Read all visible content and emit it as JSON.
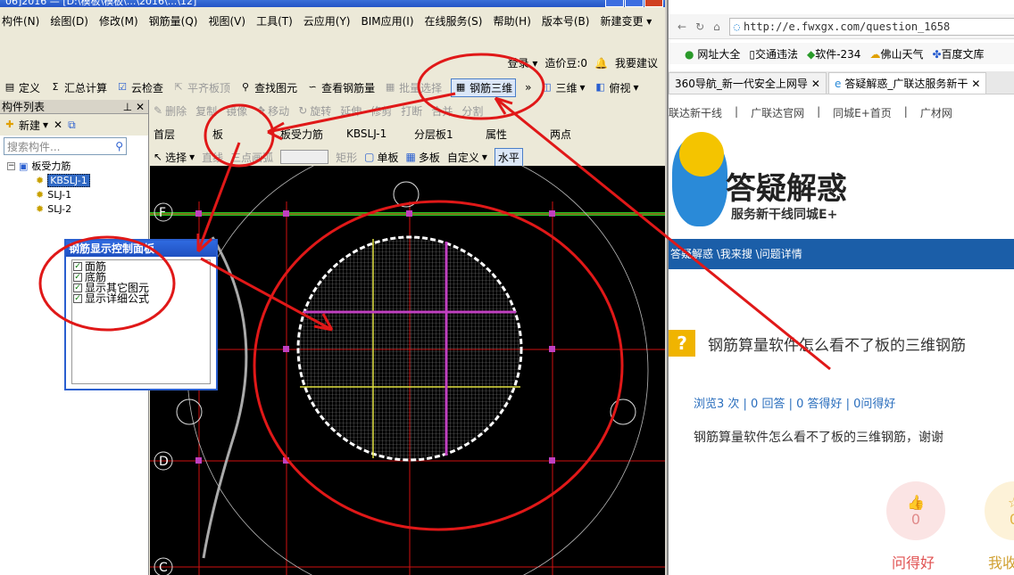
{
  "app": {
    "title_fragment": "06]2016 — [D:\\模板\\模板\\...\\2016\\...\\12]",
    "menu": [
      "构件(N)",
      "绘图(D)",
      "修改(M)",
      "钢筋量(Q)",
      "视图(V)",
      "工具(T)",
      "云应用(Y)",
      "BIM应用(I)",
      "在线服务(S)",
      "帮助(H)",
      "版本号(B)",
      "新建变更 ▾"
    ],
    "top_right": {
      "login": "登录 ▾",
      "points": "造价豆:0",
      "feedback": "我要建议"
    },
    "toolbar1": [
      "定义",
      "汇总计算",
      "云检查",
      "平齐板顶",
      "查找图元",
      "查看钢筋量",
      "批量选择",
      "钢筋三维",
      "三维",
      "俯视"
    ],
    "toolbar2": [
      "删除",
      "复制",
      "镜像",
      "移动",
      "旋转",
      "延伸",
      "修剪",
      "打断",
      "合并",
      "分割"
    ],
    "toolbar3": {
      "floor": "首层",
      "type": "板",
      "sub_type": "板受力筋",
      "component": "KBSLJ-1",
      "layer": "分层板1",
      "attr": "属性",
      "two_point": "两点"
    },
    "toolbar4": [
      "选择",
      "直线",
      "三点画弧",
      "矩形",
      "单板",
      "多板",
      "自定义",
      "水平"
    ],
    "panel": {
      "title": "构件列表",
      "new_label": "新建",
      "search_placeholder": "搜索构件...",
      "tree_root": "板受力筋",
      "tree_items": [
        "KBSLJ-1",
        "SLJ-1",
        "SLJ-2"
      ]
    },
    "axis_labels": [
      "F",
      "D",
      "C"
    ],
    "control_panel": {
      "title": "钢筋显示控制面板",
      "items": [
        "面筋",
        "底筋",
        "显示其它图元",
        "显示详细公式"
      ]
    }
  },
  "browser": {
    "url": "http://e.fwxgx.com/question_1658",
    "bookmarks": [
      "网址大全",
      "交通违法",
      "软件-234",
      "佛山天气",
      "百度文库"
    ],
    "tabs": [
      "360导航_新一代安全上网导",
      "答疑解惑_广联达服务新干"
    ],
    "site_nav": [
      "联达新干线",
      "广联达官网",
      "同城E+首页",
      "广材网"
    ],
    "logo_title": "答疑解惑",
    "logo_sub": "服务新干线同城E+",
    "breadcrumb": "答疑解惑 \\我来搜 \\问题详情",
    "question_title": "钢筋算量软件怎么看不了板的三维钢筋",
    "stats": "浏览3 次 | 0 回答 | 0 答得好 | 0问得好",
    "question_body": "钢筋算量软件怎么看不了板的三维钢筋，谢谢",
    "vote_good": {
      "count": "0",
      "label": "问得好"
    },
    "vote_fav": {
      "count": "0",
      "label": "我收"
    }
  },
  "colors": {
    "annotation_red": "#e01818",
    "cad_bg": "#000000",
    "grid_red": "#d01010",
    "green_line": "#22c822"
  }
}
